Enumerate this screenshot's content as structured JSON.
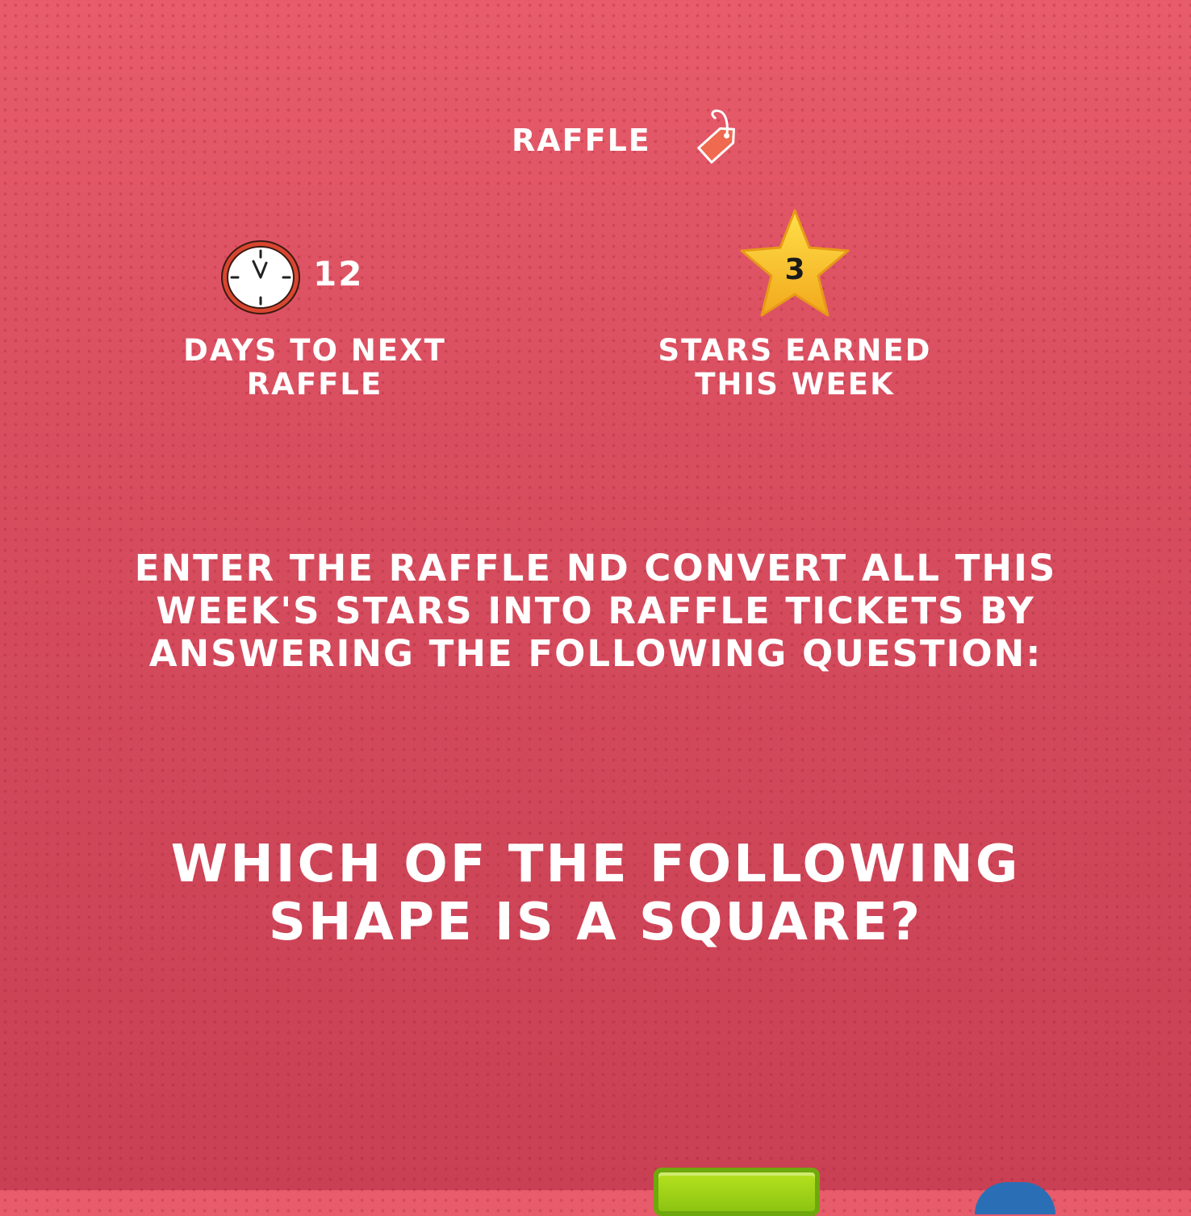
{
  "header": {
    "title": "RAFFLE",
    "icon": "price-tag-icon"
  },
  "stats": {
    "days": {
      "value": "12",
      "label": "DAYS TO NEXT RAFFLE",
      "icon": "clock-icon"
    },
    "stars": {
      "value": "3",
      "label": "STARS EARNED THIS WEEK",
      "icon": "star-icon"
    }
  },
  "instructions": "ENTER THE RAFFLE ND CONVERT ALL THIS WEEK'S STARS INTO RAFFLE TICKETS BY ANSWERING THE FOLLOWING QUESTION:",
  "question": "WHICH OF THE FOLLOWING SHAPE IS A SQUARE?",
  "colors": {
    "background": "#d94f60",
    "text": "#ffffff",
    "star": "#f7c21a",
    "tag": "#ef6a4e",
    "clock_rim": "#d9462f",
    "button_green": "#9ad11a",
    "button_blue": "#2a6fb5"
  }
}
